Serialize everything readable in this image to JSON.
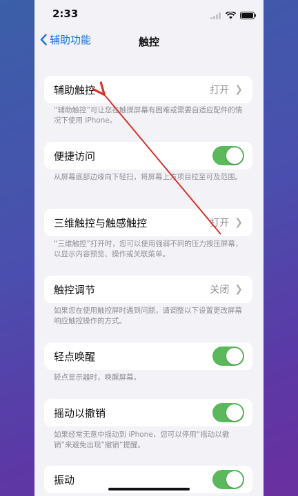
{
  "status": {
    "time": "2:33"
  },
  "nav": {
    "back_label": "辅助功能",
    "title": "触控"
  },
  "rows": [
    {
      "label": "辅助触控",
      "value": "打开",
      "footer": "“辅助触控”可让您在触摸屏幕有困难或需要自适应配件的情况下使用 iPhone。"
    },
    {
      "label": "便捷访问",
      "toggle": true,
      "footer": "从屏幕底部边缘向下轻扫，将屏幕上方项目拉至可及范围。"
    },
    {
      "label": "三维触控与触感触控",
      "value": "打开",
      "footer": "“三维触控”打开时，您可以使用强弱不同的压力按压屏幕，以显示内容预览、操作或关联菜单。"
    },
    {
      "label": "触控调节",
      "value": "关闭",
      "footer": "如果您在使用触控屏时遇到问题，请调整以下设置更改屏幕响应触控操作的方式。"
    },
    {
      "label": "轻点唤醒",
      "toggle": true,
      "footer": "轻点显示器时，唤醒屏幕。"
    },
    {
      "label": "摇动以撤销",
      "toggle": true,
      "footer": "如果经常无意中摇动到 iPhone，您可以停用“摇动以撤销”来避免出现“撤销”提醒。"
    },
    {
      "label": "振动",
      "toggle": true
    }
  ],
  "colors": {
    "accent": "#1a73e8",
    "toggle_on": "#5cb85c",
    "arrow": "#d9322b"
  }
}
